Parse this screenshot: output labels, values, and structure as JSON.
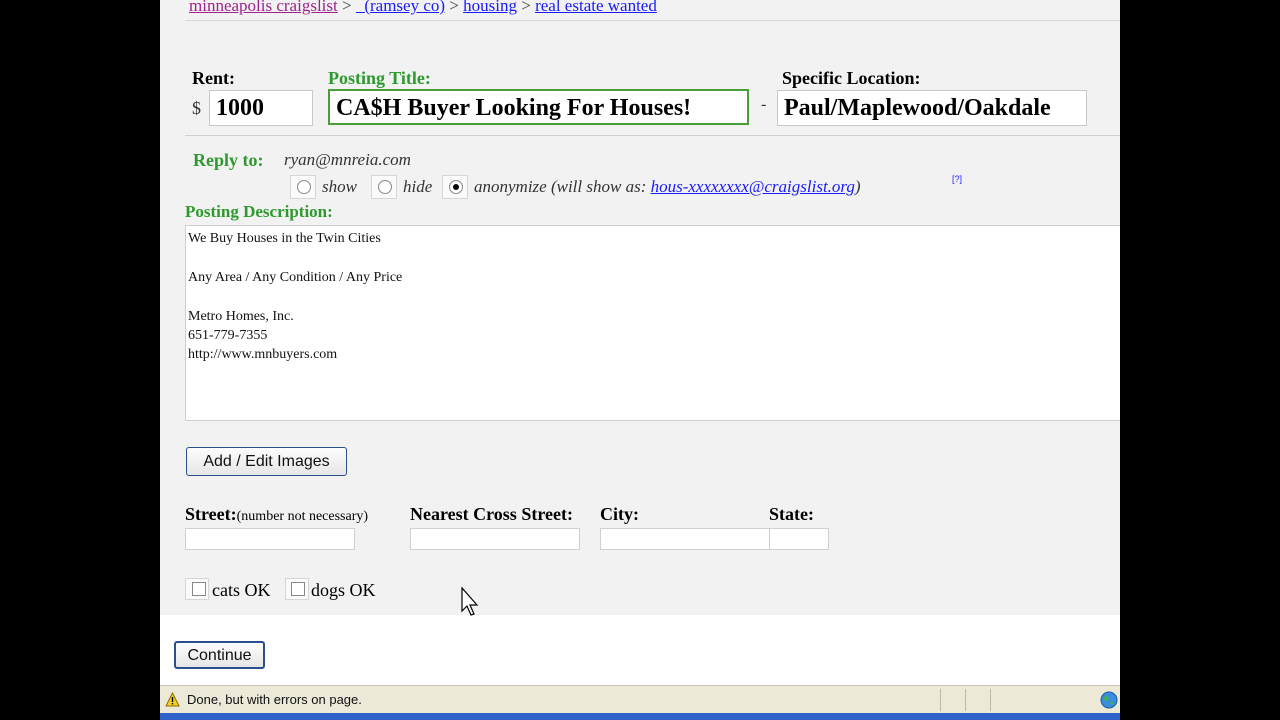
{
  "breadcrumb": {
    "site": "minneapolis craigslist",
    "sep1": ">",
    "area": "(ramsey co)",
    "sep2": ">",
    "category": "housing",
    "sep3": ">",
    "subcategory": "real estate wanted"
  },
  "rent": {
    "label": "Rent:",
    "currency": "$",
    "value": "1000"
  },
  "posting_title": {
    "label": "Posting Title:",
    "value": "CA$H Buyer Looking For Houses!"
  },
  "dash": "-",
  "specific_location": {
    "label": "Specific Location:",
    "value": "Paul/Maplewood/Oakdale"
  },
  "reply_to": {
    "label": "Reply to:",
    "email": "ryan@mnreia.com",
    "options": {
      "show": "show",
      "hide": "hide",
      "anonymize": "anonymize (will show as:"
    },
    "anon_link": "hous-xxxxxxxx@craigslist.org",
    "close_paren": ")",
    "help": "[?]",
    "selected": "anonymize"
  },
  "posting_description": {
    "label": "Posting Description:",
    "lines": [
      "We Buy Houses in the Twin Cities",
      "",
      "Any Area / Any Condition / Any Price",
      "",
      "Metro Homes, Inc.",
      "651-779-7355",
      "http://www.mnbuyers.com"
    ]
  },
  "add_images_button": "Add / Edit Images",
  "address": {
    "street_label": "Street:",
    "street_note": "(number not necessary)",
    "cross_label": "Nearest Cross Street:",
    "city_label": "City:",
    "state_label": "State:"
  },
  "pets": {
    "cats": "cats OK",
    "dogs": "dogs OK"
  },
  "continue_button": "Continue",
  "status": {
    "text": "Done, but with errors on page."
  },
  "colors": {
    "green_label": "#2e9a2e",
    "link_blue": "#1a1aff",
    "visited_purple": "#a0228e"
  }
}
